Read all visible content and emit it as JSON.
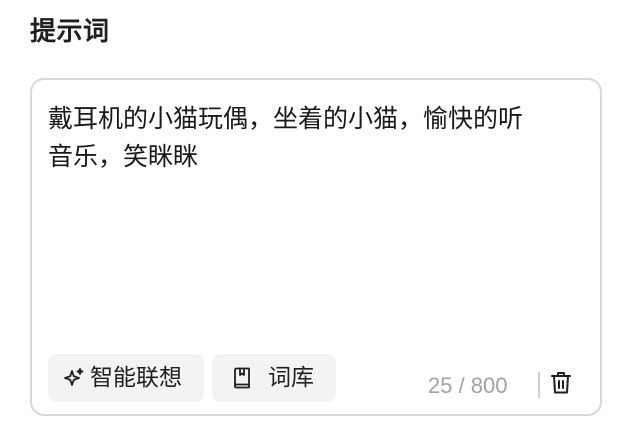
{
  "section": {
    "title": "提示词"
  },
  "prompt": {
    "text": "戴耳机的小猫玩偶，坐着的小猫，愉快的听音乐，笑眯眯",
    "char_count": "25",
    "max_chars": "800",
    "counter_text": "25 / 800"
  },
  "toolbar": {
    "assoc_label": "智能联想",
    "assoc_icon": "sparkle-icon",
    "library_label": "词库",
    "library_icon": "book-icon",
    "delete_icon": "trash-icon"
  },
  "colors": {
    "border": "#d8d8d8",
    "chip_bg": "#f3f3f3",
    "counter": "#a3a3a3",
    "text": "#1a1a1a"
  }
}
